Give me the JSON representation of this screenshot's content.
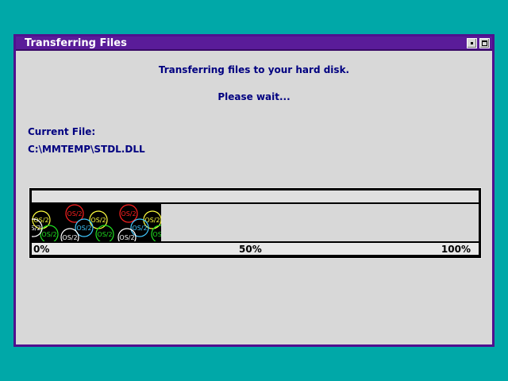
{
  "window": {
    "title": "Transferring Files",
    "buttons": [
      "minimize-icon",
      "maximize-icon"
    ]
  },
  "message": {
    "line1": "Transferring files to your hard disk.",
    "line2": "Please wait..."
  },
  "current_file": {
    "label": "Current File:",
    "path": "C:\\MMTEMP\\STDL.DLL"
  },
  "progress": {
    "fraction": 0.29,
    "logo_text": "OS/2",
    "scale": {
      "start": "0%",
      "mid": "50%",
      "end": "100%"
    }
  },
  "colors": {
    "desktop": "#00a8a8",
    "titlebar": "#5a1c99",
    "text": "#000080",
    "logo_colors": [
      "#ffff40",
      "#ff2020",
      "#20e020",
      "#40c8ff",
      "#ffffff"
    ]
  }
}
